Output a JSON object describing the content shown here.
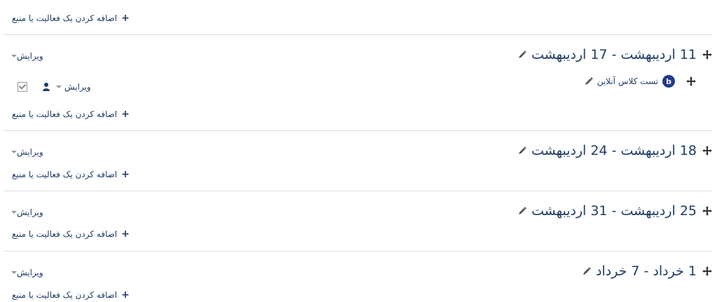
{
  "add_activity_label": "اضافه کردن یک فعالیت یا منبع",
  "edit_label": "ویرایش",
  "sections": [
    {
      "title": "11 اردیبهشت - 17 اردیبهشت"
    },
    {
      "title": "18 اردیبهشت - 24 اردیبهشت"
    },
    {
      "title": "25 اردیبهشت - 31 اردیبهشت"
    },
    {
      "title": "1 خرداد - 7 خرداد"
    }
  ],
  "activity": {
    "name": "تست کلاس آنلاین",
    "icon": "bigbluebutton-icon"
  },
  "icons": {
    "add": "plus-icon",
    "move": "move-icon",
    "edit": "pencil-icon",
    "visibility": "user-icon",
    "completion": "checkbox-icon"
  },
  "colors": {
    "text": "#1f3c66",
    "divider": "#dcdcdc",
    "bbb": "#233a8c"
  }
}
